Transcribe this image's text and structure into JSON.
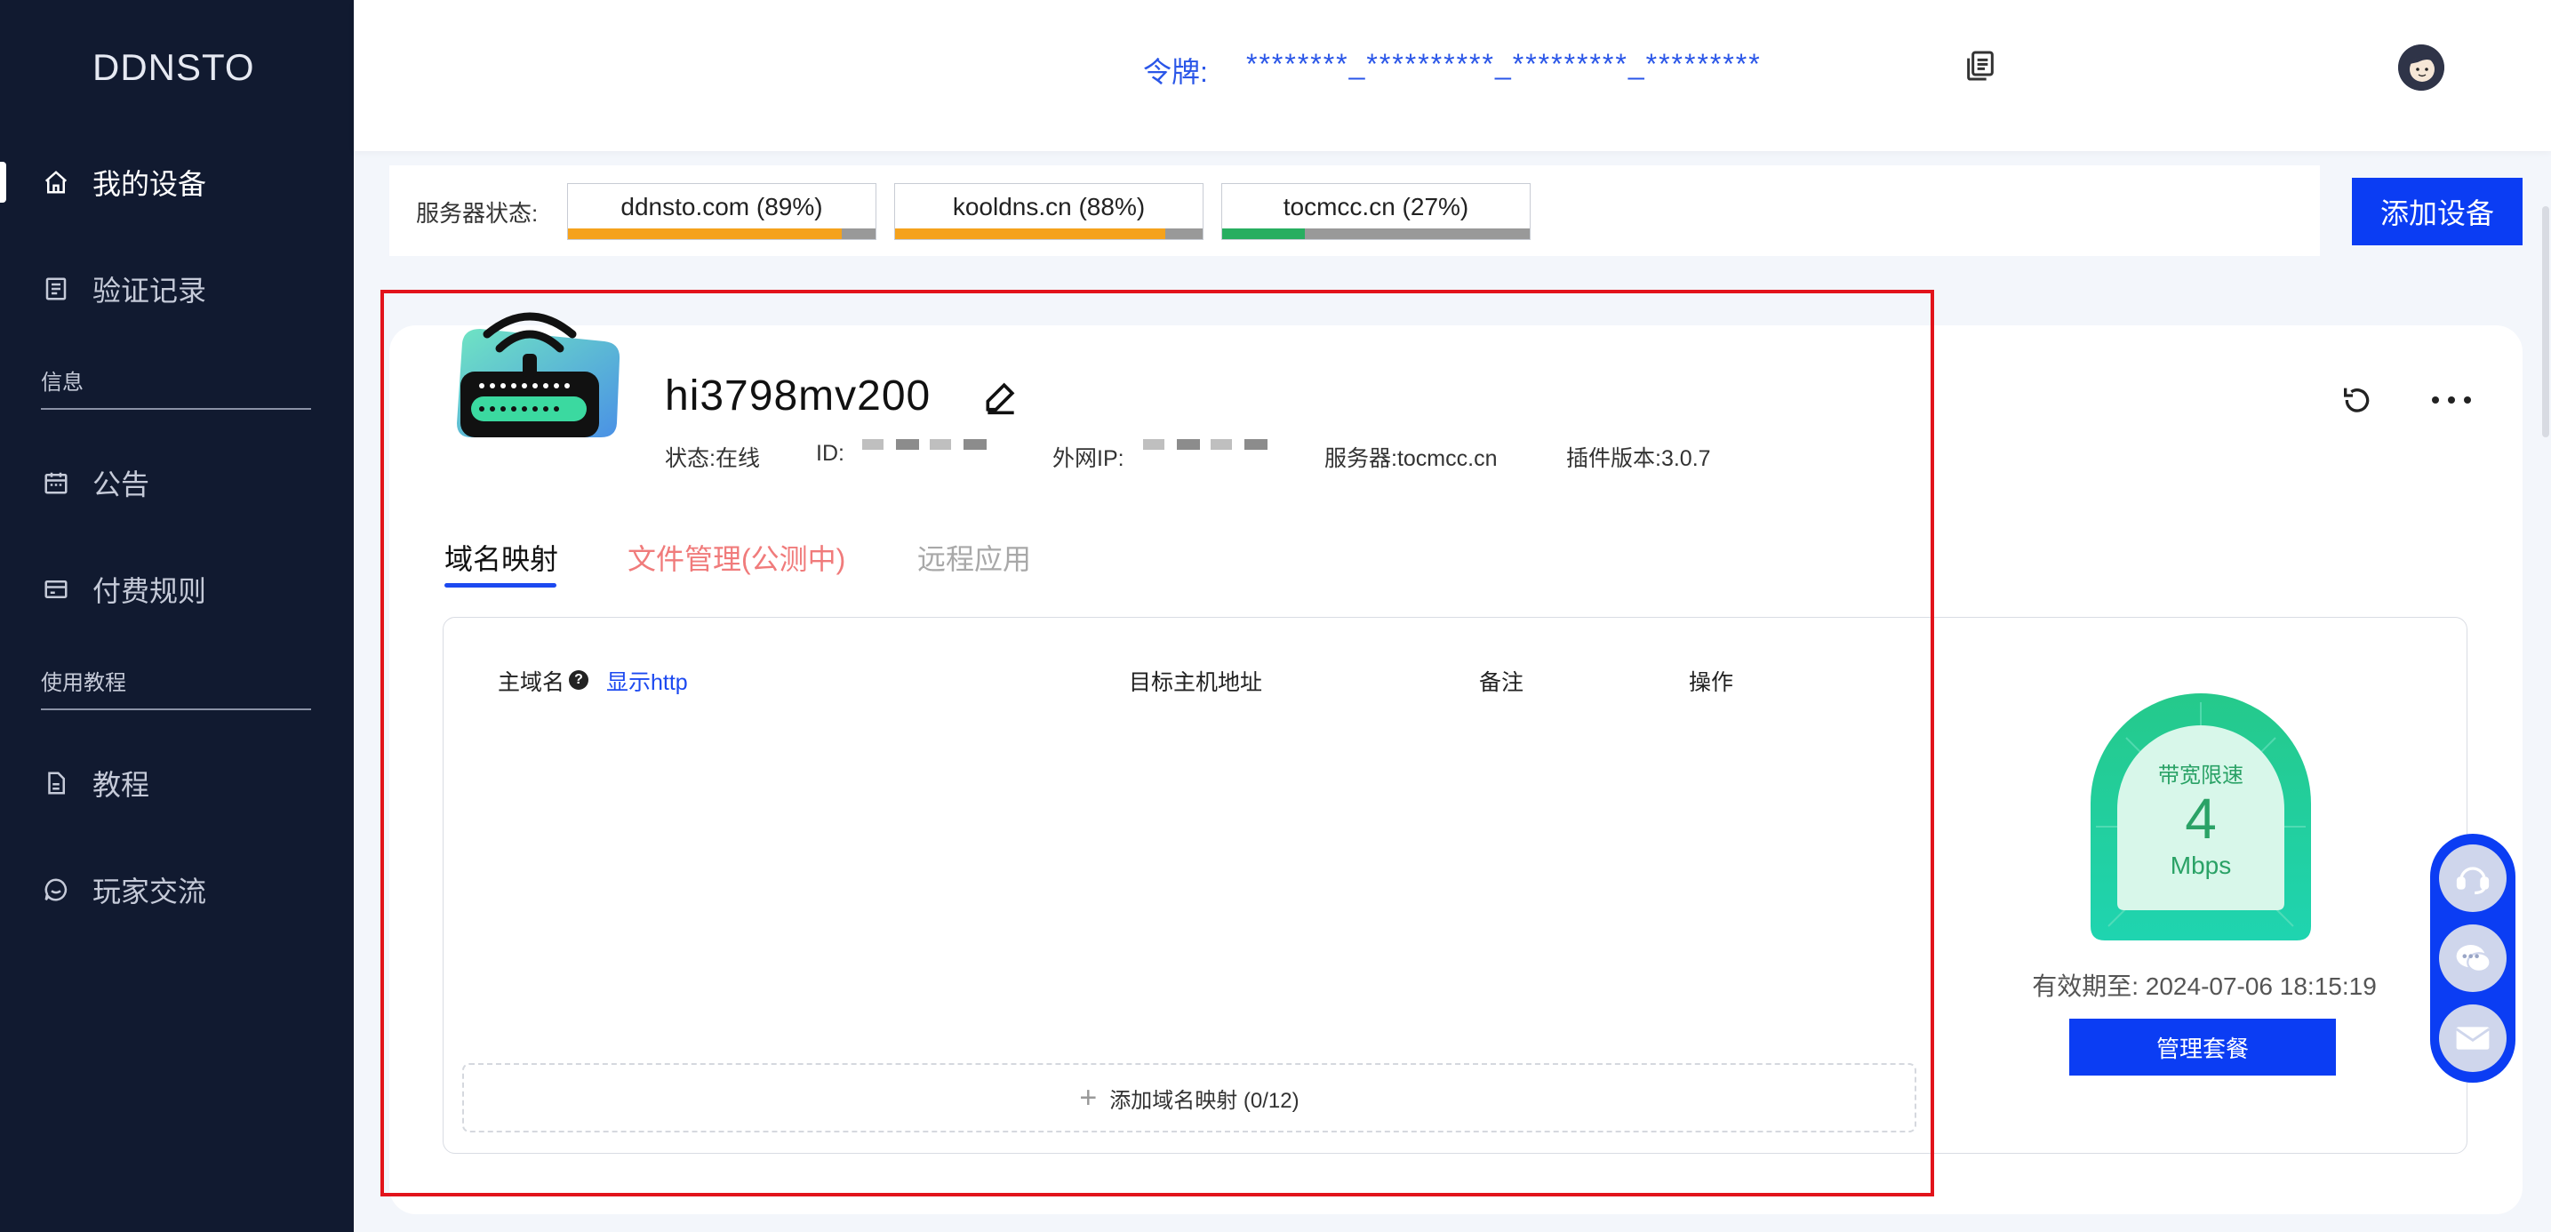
{
  "app": {
    "logo": "DDNSTO"
  },
  "sidebar": {
    "items": [
      {
        "label": "我的设备",
        "icon": "home-icon"
      },
      {
        "label": "验证记录",
        "icon": "list-icon"
      },
      {
        "label": "公告",
        "icon": "calendar-icon"
      },
      {
        "label": "付费规则",
        "icon": "card-icon"
      },
      {
        "label": "教程",
        "icon": "document-icon"
      },
      {
        "label": "玩家交流",
        "icon": "chat-icon"
      }
    ],
    "sections": {
      "info": "信息",
      "tutorial": "使用教程"
    }
  },
  "header": {
    "token_label": "令牌:",
    "token_value": "********_**********_*********_*********"
  },
  "server_status": {
    "label": "服务器状态:",
    "servers": [
      {
        "name": "ddnsto.com (89%)",
        "percent": 89,
        "color": "#f5a21c"
      },
      {
        "name": "kooldns.cn (88%)",
        "percent": 88,
        "color": "#f5a21c"
      },
      {
        "name": "tocmcc.cn (27%)",
        "percent": 27,
        "color": "#27ae60"
      }
    ]
  },
  "add_device_label": "添加设备",
  "device": {
    "name": "hi3798mv200",
    "status": "状态:在线",
    "id_label": "ID:",
    "ip_label": "外网IP:",
    "server": "服务器:tocmcc.cn",
    "plugin_version": "插件版本:3.0.7"
  },
  "tabs": [
    {
      "label": "域名映射",
      "active": true,
      "color": "#111111"
    },
    {
      "label": "文件管理(公测中)",
      "active": false,
      "color": "#f07b7b"
    },
    {
      "label": "远程应用",
      "active": false,
      "color": "#a8a8a8"
    }
  ],
  "table": {
    "headers": {
      "domain": "主域名",
      "target": "目标主机地址",
      "note": "备注",
      "action": "操作"
    },
    "show_http": "显示http",
    "add_mapping": "添加域名映射 (0/12)"
  },
  "bandwidth": {
    "title": "带宽限速",
    "value": "4",
    "unit": "Mbps",
    "expiry": "有效期至: 2024-07-06 18:15:19",
    "manage_label": "管理套餐"
  },
  "colors": {
    "accent": "#0b3df3",
    "sidebar_bg": "#111a30",
    "highlight": "#e2131b"
  }
}
